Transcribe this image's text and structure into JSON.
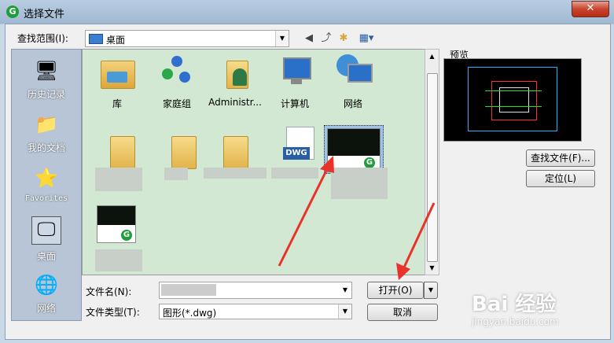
{
  "window": {
    "title": "选择文件",
    "close_label": "✕"
  },
  "look_in": {
    "label": "查找范围(I):",
    "value": "桌面"
  },
  "places": [
    {
      "label": "历史记录",
      "icon": "history-icon"
    },
    {
      "label": "我的文档",
      "icon": "documents-icon"
    },
    {
      "label": "Favorites",
      "icon": "favorites-icon"
    },
    {
      "label": "桌面",
      "icon": "desktop-icon"
    },
    {
      "label": "网络",
      "icon": "network-icon"
    }
  ],
  "files": [
    {
      "label": "库",
      "icon": "library-icon"
    },
    {
      "label": "家庭组",
      "icon": "homegroup-icon"
    },
    {
      "label": "Administr...",
      "icon": "user-folder-icon"
    },
    {
      "label": "计算机",
      "icon": "computer-icon"
    },
    {
      "label": "网络",
      "icon": "network-icon"
    }
  ],
  "file_name": {
    "label": "文件名(N):",
    "value": ""
  },
  "file_type": {
    "label": "文件类型(T):",
    "value": "图形(*.dwg)"
  },
  "buttons": {
    "open": "打开(O)",
    "cancel": "取消",
    "find_file": "查找文件(F)...",
    "locate": "定位(L)"
  },
  "preview": {
    "label": "预览"
  },
  "watermark": {
    "brand": "Bai 经验",
    "url": "jingyan.baidu.com"
  },
  "colors": {
    "list_bg": "#d3e8d2",
    "arrow": "#e8332a"
  }
}
